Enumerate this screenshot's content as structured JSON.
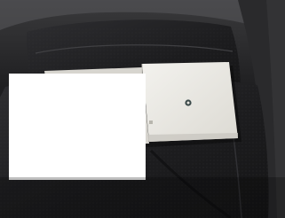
{
  "image": {
    "subject": "car-seat-with-booklet",
    "colors": {
      "seat_dark": "#1c1c1e",
      "seat_mid": "#2b2b2e",
      "booklet": "#e9e7e1",
      "redaction": "#ffffff"
    }
  }
}
